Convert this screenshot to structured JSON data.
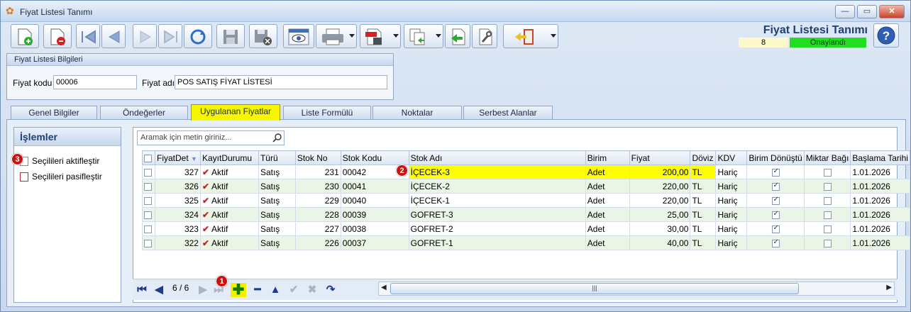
{
  "window": {
    "title": "Fiyat Listesi Tanımı",
    "buttons": {
      "minimize": "—",
      "maximize": "▭",
      "close": "✕"
    }
  },
  "toolbar": {
    "icons": [
      "new-doc-icon",
      "delete-doc-icon",
      "first-icon",
      "prev-icon",
      "next-icon",
      "last-icon",
      "refresh-icon",
      "save-icon",
      "save-close-icon",
      "preview-icon",
      "print-icon",
      "pdf-export-icon",
      "copy-icon",
      "import-icon",
      "tools-icon",
      "exit-icon",
      "help-icon"
    ]
  },
  "header": {
    "title": "Fiyat Listesi Tanımı",
    "count": "8",
    "status": "Onaylandı",
    "status_color": "#22dd22"
  },
  "info_group": {
    "title": "Fiyat Listesi Bilgileri",
    "code_label": "Fiyat kodu",
    "code_value": "00006",
    "name_label": "Fiyat adı",
    "name_value": "POS SATIŞ FİYAT LİSTESİ"
  },
  "tabs": [
    {
      "label": "Genel Bilgiler"
    },
    {
      "label": "Öndeğerler"
    },
    {
      "label": "Uygulanan Fiyatlar"
    },
    {
      "label": "Liste Formülü"
    },
    {
      "label": "Noktalar"
    },
    {
      "label": "Serbest Alanlar"
    }
  ],
  "operations": {
    "title": "İşlemler",
    "items": [
      "Seçilileri aktifleştir",
      "Seçilileri pasifleştir"
    ]
  },
  "search": {
    "placeholder": "Aramak için metin giriniz..."
  },
  "grid": {
    "columns": [
      "FiyatDet",
      "KayıtDurumu",
      "Türü",
      "Stok No",
      "Stok Kodu",
      "Stok Adı",
      "Birim",
      "Fiyat",
      "Döviz",
      "KDV",
      "Birim Dönüştü",
      "Miktar Bağı",
      "Başlama Tarihi"
    ],
    "rows": [
      {
        "id": "327",
        "status": "Aktif",
        "type": "Satış",
        "stock_no": "231",
        "stock_code": "00042",
        "stock_name": "İÇECEK-3",
        "unit": "Adet",
        "price": "200,00",
        "currency": "TL",
        "vat": "Hariç",
        "unit_conv": true,
        "qty_bound": false,
        "start": "1.01.2026"
      },
      {
        "id": "326",
        "status": "Aktif",
        "type": "Satış",
        "stock_no": "230",
        "stock_code": "00041",
        "stock_name": "İÇECEK-2",
        "unit": "Adet",
        "price": "220,00",
        "currency": "TL",
        "vat": "Hariç",
        "unit_conv": true,
        "qty_bound": false,
        "start": "1.01.2026"
      },
      {
        "id": "325",
        "status": "Aktif",
        "type": "Satış",
        "stock_no": "229",
        "stock_code": "00040",
        "stock_name": "İÇECEK-1",
        "unit": "Adet",
        "price": "220,00",
        "currency": "TL",
        "vat": "Hariç",
        "unit_conv": true,
        "qty_bound": false,
        "start": "1.01.2026"
      },
      {
        "id": "324",
        "status": "Aktif",
        "type": "Satış",
        "stock_no": "228",
        "stock_code": "00039",
        "stock_name": "GOFRET-3",
        "unit": "Adet",
        "price": "25,00",
        "currency": "TL",
        "vat": "Hariç",
        "unit_conv": true,
        "qty_bound": false,
        "start": "1.01.2026"
      },
      {
        "id": "323",
        "status": "Aktif",
        "type": "Satış",
        "stock_no": "227",
        "stock_code": "00038",
        "stock_name": "GOFRET-2",
        "unit": "Adet",
        "price": "30,00",
        "currency": "TL",
        "vat": "Hariç",
        "unit_conv": true,
        "qty_bound": false,
        "start": "1.01.2026"
      },
      {
        "id": "322",
        "status": "Aktif",
        "type": "Satış",
        "stock_no": "226",
        "stock_code": "00037",
        "stock_name": "GOFRET-1",
        "unit": "Adet",
        "price": "40,00",
        "currency": "TL",
        "vat": "Hariç",
        "unit_conv": true,
        "qty_bound": false,
        "start": "1.01.2026"
      }
    ]
  },
  "navigator": {
    "pager": "6 / 6",
    "scroll_grip": "|||"
  },
  "badges": [
    "1",
    "2",
    "3"
  ]
}
